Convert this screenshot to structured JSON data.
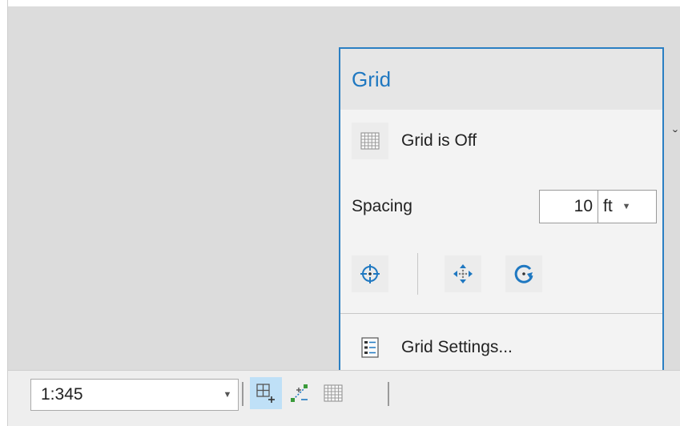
{
  "popup": {
    "title": "Grid",
    "grid_state_label": "Grid is Off",
    "spacing_label": "Spacing",
    "spacing_value": "10",
    "spacing_unit": "ft",
    "settings_label": "Grid Settings..."
  },
  "statusbar": {
    "scale_value": "1:345"
  },
  "colors": {
    "accent": "#1f78c1",
    "popup_border": "#2b7fc3",
    "active_button": "#bfe0f7"
  }
}
